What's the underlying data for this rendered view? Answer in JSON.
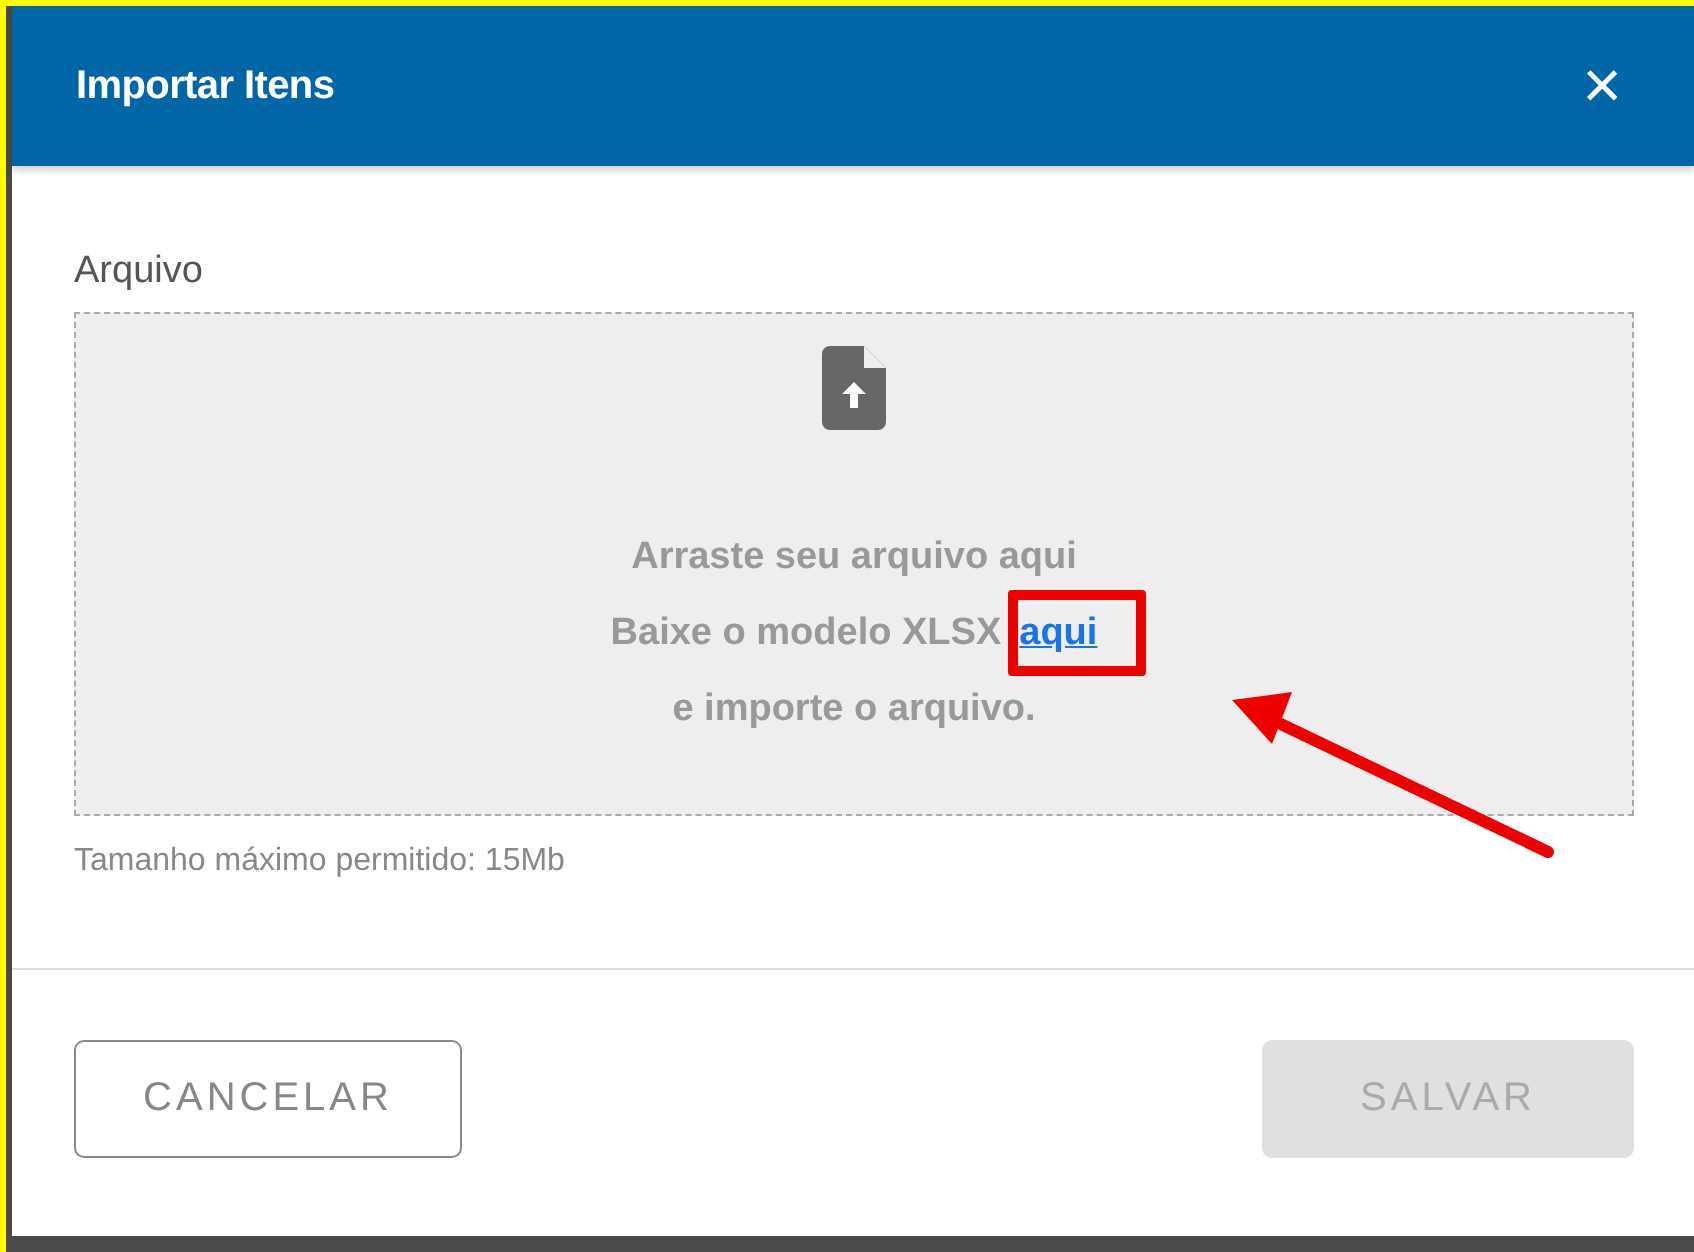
{
  "dialog": {
    "title": "Importar Itens",
    "close": "×"
  },
  "field": {
    "label": "Arquivo",
    "drop_lines": [
      "Arraste seu arquivo aqui",
      "Baixe o modelo XLSX",
      "e importe o arquivo."
    ],
    "template_link": "aqui",
    "hint": "Tamanho máximo permitido: 15Mb"
  },
  "buttons": [
    {
      "label": "CANCELAR",
      "kind": "outline",
      "disabled": false
    },
    {
      "label": "SALVAR",
      "kind": "filled",
      "disabled": true
    }
  ]
}
